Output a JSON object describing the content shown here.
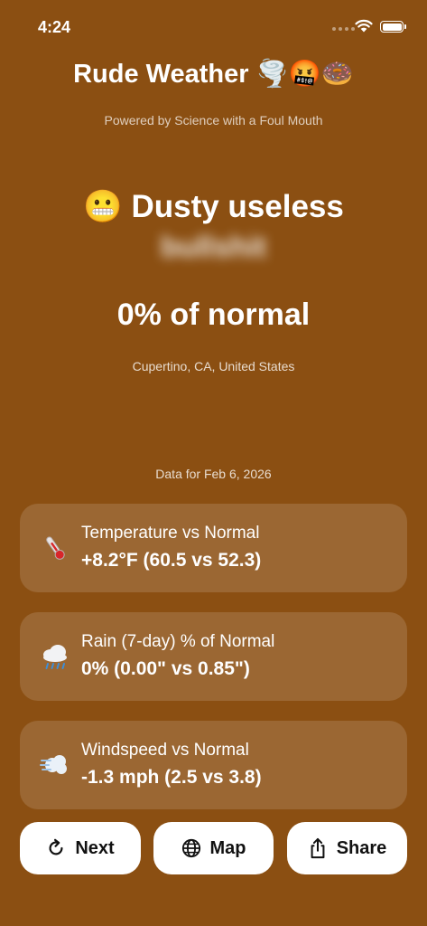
{
  "status": {
    "time": "4:24"
  },
  "header": {
    "title": "Rude Weather",
    "title_emojis": "🌪️🤬🍩",
    "subtitle": "Powered by Science with a Foul Mouth"
  },
  "summary": {
    "emoji": "😬",
    "headline": "Dusty useless",
    "censored_word": "bullshit",
    "percent_text": "0% of normal",
    "location": "Cupertino, CA, United States",
    "data_date": "Data for Feb 6, 2026"
  },
  "cards": [
    {
      "icon": "thermometer-icon",
      "emoji": "🌡️",
      "label": "Temperature vs Normal",
      "value": "+8.2°F (60.5 vs 52.3)"
    },
    {
      "icon": "rain-cloud-icon",
      "emoji": "🌧️",
      "label": "Rain (7-day) % of Normal",
      "value": "0% (0.00\" vs 0.85\")"
    },
    {
      "icon": "wind-icon",
      "emoji": "💨",
      "label": "Windspeed vs Normal",
      "value": "-1.3 mph (2.5 vs 3.8)"
    }
  ],
  "actions": {
    "next_label": "Next",
    "map_label": "Map",
    "share_label": "Share"
  },
  "colors": {
    "background": "#8b4f12",
    "card": "rgba(255,255,255,0.14)",
    "button": "#ffffff"
  }
}
